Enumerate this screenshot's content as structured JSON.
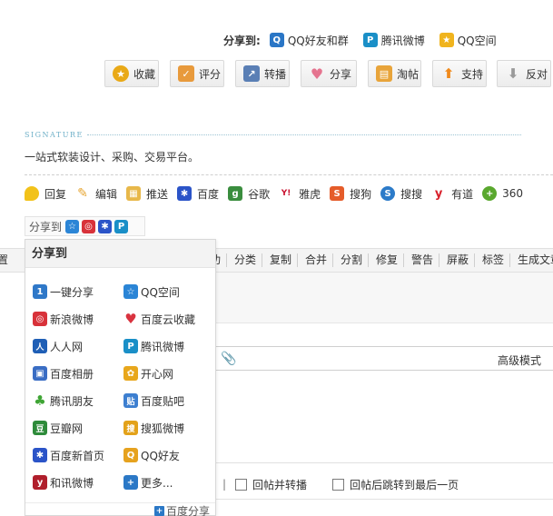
{
  "share_top": {
    "label": "分享到:",
    "items": [
      {
        "label": "QQ好友和群",
        "icon": "qq-penguin-icon",
        "glyph": "Q",
        "color": "#2a76c6"
      },
      {
        "label": "腾讯微博",
        "icon": "tencent-weibo-icon",
        "glyph": "P",
        "color": "#1a8fc7"
      },
      {
        "label": "QQ空间",
        "icon": "qzone-star-icon",
        "glyph": "★",
        "color": "#f0b41e"
      }
    ]
  },
  "actions": [
    {
      "label": "收藏",
      "icon": "star-icon",
      "glyph": "★",
      "color": "#e9a917"
    },
    {
      "label": "评分",
      "icon": "thumbs-up-icon",
      "glyph": "👍",
      "color": "#e89a3c"
    },
    {
      "label": "转播",
      "icon": "forward-icon",
      "glyph": "↗",
      "color": "#5a7fb5"
    },
    {
      "label": "分享",
      "icon": "heart-icon",
      "glyph": "♥",
      "color": "#e5748f"
    },
    {
      "label": "淘帖",
      "icon": "tray-icon",
      "glyph": "▤",
      "color": "#e8a43a"
    },
    {
      "label": "支持",
      "icon": "up-arrow-icon",
      "glyph": "⬆",
      "color": "#f08a1c"
    },
    {
      "label": "反对",
      "icon": "down-arrow-icon",
      "glyph": "⬇",
      "color": "#9a9a9a"
    }
  ],
  "signature": {
    "heading": "SIGNATURE",
    "text": "一站式软装设计、采购、交易平台。"
  },
  "links": [
    {
      "label": "回复",
      "icon": "reply-bubble-icon",
      "glyph": "",
      "color": "#f2c21a"
    },
    {
      "label": "编辑",
      "icon": "pencil-icon",
      "glyph": "✎",
      "color": "#e6a532"
    },
    {
      "label": "推送",
      "icon": "push-document-icon",
      "glyph": "▦",
      "color": "#e8b84a"
    },
    {
      "label": "百度",
      "icon": "baidu-paw-icon",
      "glyph": "✱",
      "color": "#2b54c8"
    },
    {
      "label": "谷歌",
      "icon": "google-icon",
      "glyph": "g",
      "color": "#3a8d3e"
    },
    {
      "label": "雅虎",
      "icon": "yahoo-icon",
      "glyph": "Y!",
      "color": "#c8102e"
    },
    {
      "label": "搜狗",
      "icon": "sogou-icon",
      "glyph": "S",
      "color": "#e55c2a"
    },
    {
      "label": "搜搜",
      "icon": "soso-icon",
      "glyph": "S",
      "color": "#2c7bc9"
    },
    {
      "label": "有道",
      "icon": "youdao-icon",
      "glyph": "y",
      "color": "#d8202b"
    },
    {
      "label": "360",
      "icon": "360-icon",
      "glyph": "+",
      "color": "#5aa82e"
    }
  ],
  "sharebar": {
    "label": "分享到",
    "icons": [
      {
        "icon": "qzone-icon",
        "glyph": "☆",
        "color": "#2b85d6"
      },
      {
        "icon": "sina-weibo-icon",
        "glyph": "◎",
        "color": "#d8323a"
      },
      {
        "icon": "baidu-paw-icon",
        "glyph": "✱",
        "color": "#2b54c8"
      },
      {
        "icon": "tencent-weibo-icon",
        "glyph": "P",
        "color": "#1a8fc7"
      }
    ]
  },
  "modbar": {
    "left_char": "置",
    "left_partial": "功",
    "items": [
      "分类",
      "复制",
      "合并",
      "分割",
      "修复",
      "警告",
      "屏蔽",
      "标签",
      "生成文章"
    ]
  },
  "editor": {
    "advanced_mode": "高级模式"
  },
  "reply_options": [
    "回帖并转播",
    "回帖后跳转到最后一页"
  ],
  "popup": {
    "title": "分享到",
    "items": [
      {
        "label": "一键分享",
        "icon": "one-click-share-icon",
        "glyph": "1",
        "color": "#2f78c8"
      },
      {
        "label": "QQ空间",
        "icon": "qzone-icon",
        "glyph": "☆",
        "color": "#2b85d6"
      },
      {
        "label": "新浪微博",
        "icon": "sina-weibo-icon",
        "glyph": "◎",
        "color": "#d8323a"
      },
      {
        "label": "百度云收藏",
        "icon": "heart-icon",
        "glyph": "♥",
        "color": "#d9333f"
      },
      {
        "label": "人人网",
        "icon": "renren-icon",
        "glyph": "人",
        "color": "#1f5fb6"
      },
      {
        "label": "腾讯微博",
        "icon": "tencent-weibo-icon",
        "glyph": "P",
        "color": "#1a8fc7"
      },
      {
        "label": "百度相册",
        "icon": "baidu-album-icon",
        "glyph": "▣",
        "color": "#3a6dc4"
      },
      {
        "label": "开心网",
        "icon": "kaixin-icon",
        "glyph": "✿",
        "color": "#e8a71c"
      },
      {
        "label": "腾讯朋友",
        "icon": "clover-icon",
        "glyph": "♣",
        "color": "#3fa535"
      },
      {
        "label": "百度贴吧",
        "icon": "tieba-icon",
        "glyph": "贴",
        "color": "#3d7fd0"
      },
      {
        "label": "豆瓣网",
        "icon": "douban-icon",
        "glyph": "豆",
        "color": "#2e8b3a"
      },
      {
        "label": "搜狐微博",
        "icon": "sohu-weibo-icon",
        "glyph": "搜",
        "color": "#e3a21a"
      },
      {
        "label": "百度新首页",
        "icon": "baidu-paw-icon",
        "glyph": "✱",
        "color": "#2b54c8"
      },
      {
        "label": "QQ好友",
        "icon": "qq-penguin-icon",
        "glyph": "Q",
        "color": "#e6a21e"
      },
      {
        "label": "和讯微博",
        "icon": "hexun-icon",
        "glyph": "y",
        "color": "#b01f2c"
      },
      {
        "label": "更多...",
        "icon": "plus-icon",
        "glyph": "+",
        "color": "#2b78c6"
      }
    ],
    "footer": "百度分享",
    "footer_icon": {
      "icon": "plus-icon",
      "glyph": "+",
      "color": "#2b78c6"
    }
  }
}
